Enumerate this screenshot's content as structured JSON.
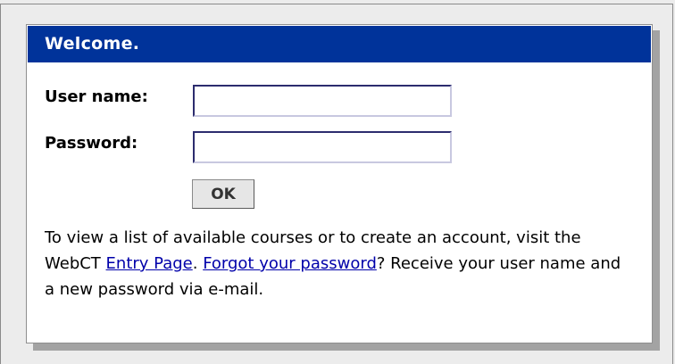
{
  "panel": {
    "title": "Welcome."
  },
  "form": {
    "username_label": "User name:",
    "username_value": "",
    "password_label": "Password:",
    "password_value": "",
    "ok_label": "OK"
  },
  "info": {
    "text_before": "To view a list of available courses or to create an account, visit the WebCT ",
    "entry_link": "Entry Page",
    "text_middle": ". ",
    "forgot_link": "Forgot your password",
    "text_after": "? Receive your user name and a new password via e-mail."
  },
  "colors": {
    "header_bg": "#00339a",
    "link": "#0000aa",
    "page_bg": "#ececec"
  }
}
